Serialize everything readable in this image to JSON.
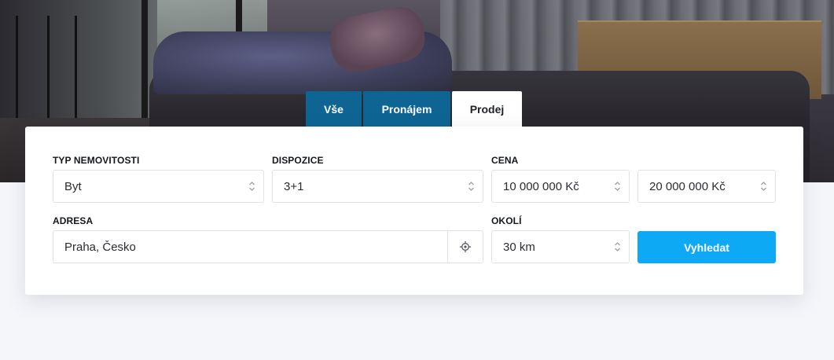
{
  "tabs": [
    {
      "label": "Vše",
      "active": false
    },
    {
      "label": "Pronájem",
      "active": false
    },
    {
      "label": "Prodej",
      "active": true
    }
  ],
  "form": {
    "property_type": {
      "label": "TYP NEMOVITOSTI",
      "value": "Byt"
    },
    "layout": {
      "label": "DISPOZICE",
      "value": "3+1"
    },
    "price": {
      "label": "CENA",
      "min": "10 000 000 Kč",
      "max": "20 000 000 Kč"
    },
    "address": {
      "label": "ADRESA",
      "value": "Praha, Česko"
    },
    "radius": {
      "label": "OKOLÍ",
      "value": "30 km"
    },
    "search_button": "Vyhledat"
  },
  "icons": {
    "select_chevron": "chevron-updown-icon",
    "locate": "crosshair-icon"
  },
  "colors": {
    "tab_inactive": "#0e6593",
    "tab_active": "#ffffff",
    "primary_button": "#0ea9f5",
    "page_background": "#f5f6fa"
  }
}
